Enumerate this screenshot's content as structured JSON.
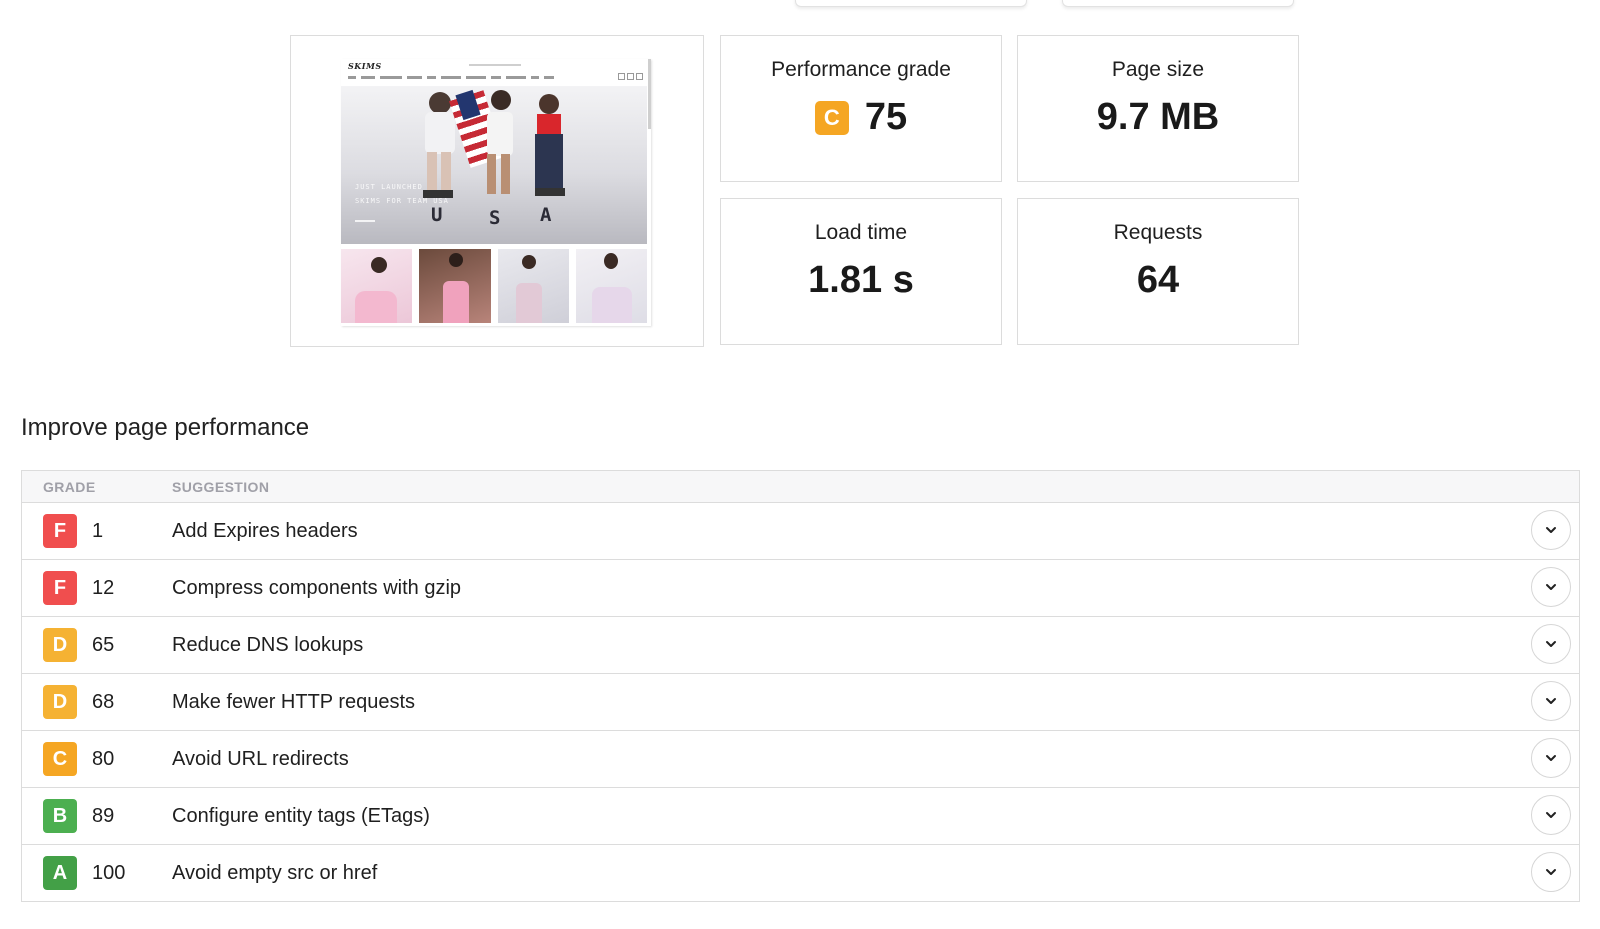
{
  "preview": {
    "site_logo": "SKIMS",
    "hero_line_1": "JUST LAUNCHED",
    "hero_line_2": "SKIMS FOR TEAM USA",
    "hero_letters": [
      "U",
      "S",
      "A"
    ]
  },
  "metrics": {
    "performance_grade": {
      "label": "Performance grade",
      "grade": "C",
      "value": "75",
      "grade_color": "#f5a623"
    },
    "page_size": {
      "label": "Page size",
      "value": "9.7 MB"
    },
    "load_time": {
      "label": "Load time",
      "value": "1.81 s"
    },
    "requests": {
      "label": "Requests",
      "value": "64"
    }
  },
  "section": {
    "title": "Improve page performance"
  },
  "table": {
    "headers": {
      "grade": "GRADE",
      "suggestion": "SUGGESTION"
    },
    "rows": [
      {
        "grade": "F",
        "score": "1",
        "suggestion": "Add Expires headers",
        "color": "#f04e4e"
      },
      {
        "grade": "F",
        "score": "12",
        "suggestion": "Compress components with gzip",
        "color": "#f04e4e"
      },
      {
        "grade": "D",
        "score": "65",
        "suggestion": "Reduce DNS lookups",
        "color": "#f5b233"
      },
      {
        "grade": "D",
        "score": "68",
        "suggestion": "Make fewer HTTP requests",
        "color": "#f5b233"
      },
      {
        "grade": "C",
        "score": "80",
        "suggestion": "Avoid URL redirects",
        "color": "#f5a623"
      },
      {
        "grade": "B",
        "score": "89",
        "suggestion": "Configure entity tags (ETags)",
        "color": "#4caf50"
      },
      {
        "grade": "A",
        "score": "100",
        "suggestion": "Avoid empty src or href",
        "color": "#43a047"
      }
    ],
    "expand_icon": "chevron-down-icon"
  }
}
